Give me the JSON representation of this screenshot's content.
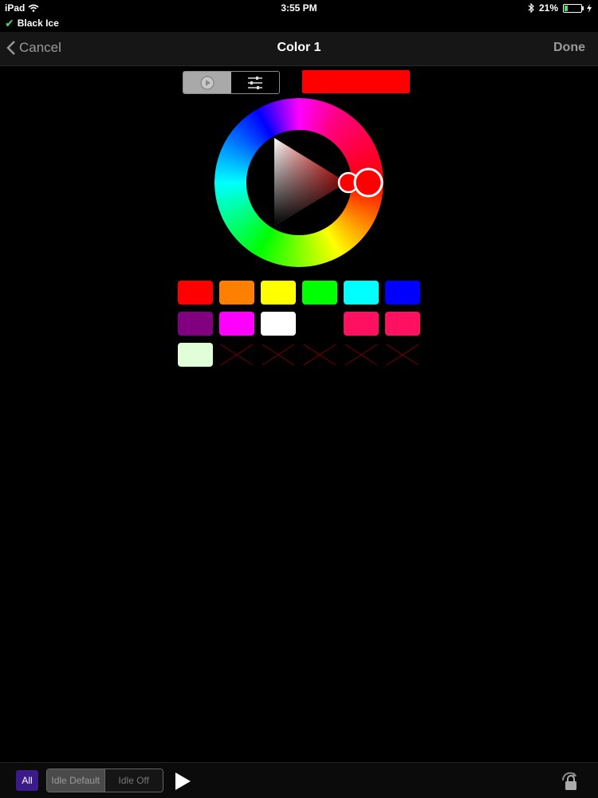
{
  "status_bar": {
    "device": "iPad",
    "time": "3:55 PM",
    "battery_percent": "21%",
    "battery_level": 0.21,
    "wifi_icon": "wifi-icon",
    "bluetooth_icon": "bluetooth-icon"
  },
  "connection": {
    "name": "Black Ice"
  },
  "nav": {
    "back_label": "Cancel",
    "title": "Color 1",
    "done_label": "Done"
  },
  "picker": {
    "selected_color": "#ff0000",
    "mode_icons": [
      "play-mode-icon",
      "sliders-icon"
    ]
  },
  "palette": {
    "colors": [
      "#ff0000",
      "#ff8000",
      "#ffff00",
      "#00ff00",
      "#00ffff",
      "#0000ff",
      "#800080",
      "#ff00ff",
      "#ffffff",
      null,
      "#ff1060",
      "#ff1060",
      "#e0ffd8",
      null,
      null,
      null,
      null,
      null
    ],
    "empty_marker": "red-x"
  },
  "bottom_bar": {
    "all_label": "All",
    "idle_default_label": "Idle Default",
    "idle_off_label": "Idle Off",
    "accent": "#3b1a8a"
  }
}
